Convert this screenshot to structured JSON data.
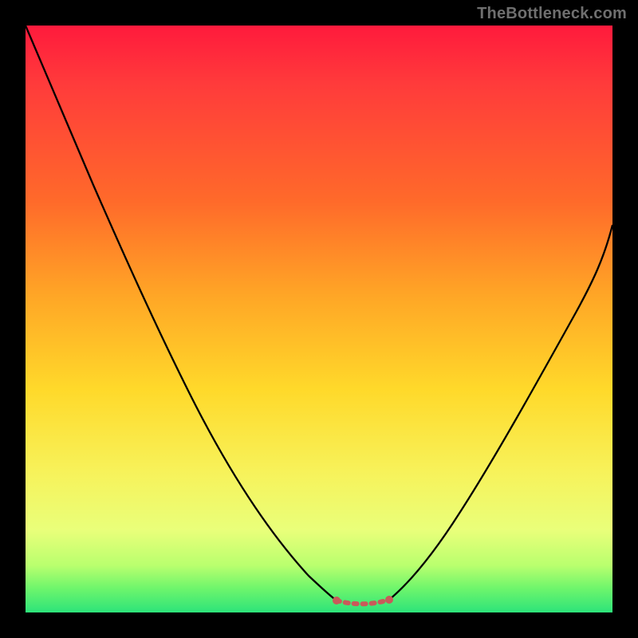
{
  "watermark": "TheBottleneck.com",
  "chart_data": {
    "type": "line",
    "title": "",
    "xlabel": "",
    "ylabel": "",
    "xlim": [
      0,
      1
    ],
    "ylim": [
      0,
      1
    ],
    "grid": false,
    "legend": false,
    "gradient_colors": [
      "#ff1a3c",
      "#ff6a2a",
      "#ffd92a",
      "#e9ff7a",
      "#2de37a"
    ],
    "series": [
      {
        "name": "left-curve",
        "stroke": "#000000",
        "x": [
          0.0,
          0.05,
          0.1,
          0.15,
          0.2,
          0.25,
          0.3,
          0.35,
          0.4,
          0.45,
          0.5,
          0.53
        ],
        "y": [
          1.0,
          0.89,
          0.79,
          0.693,
          0.6,
          0.51,
          0.423,
          0.338,
          0.255,
          0.175,
          0.093,
          0.04
        ]
      },
      {
        "name": "right-curve",
        "stroke": "#000000",
        "x": [
          0.62,
          0.66,
          0.7,
          0.74,
          0.78,
          0.82,
          0.86,
          0.9,
          0.94,
          0.98,
          1.0
        ],
        "y": [
          0.04,
          0.085,
          0.14,
          0.2,
          0.263,
          0.33,
          0.4,
          0.472,
          0.545,
          0.62,
          0.66
        ]
      },
      {
        "name": "trough-marker",
        "stroke": "#c95a5a",
        "marker": "circle",
        "x": [
          0.53,
          0.545,
          0.56,
          0.575,
          0.59,
          0.605,
          0.62
        ],
        "y": [
          0.04,
          0.028,
          0.022,
          0.02,
          0.022,
          0.028,
          0.04
        ]
      }
    ]
  }
}
